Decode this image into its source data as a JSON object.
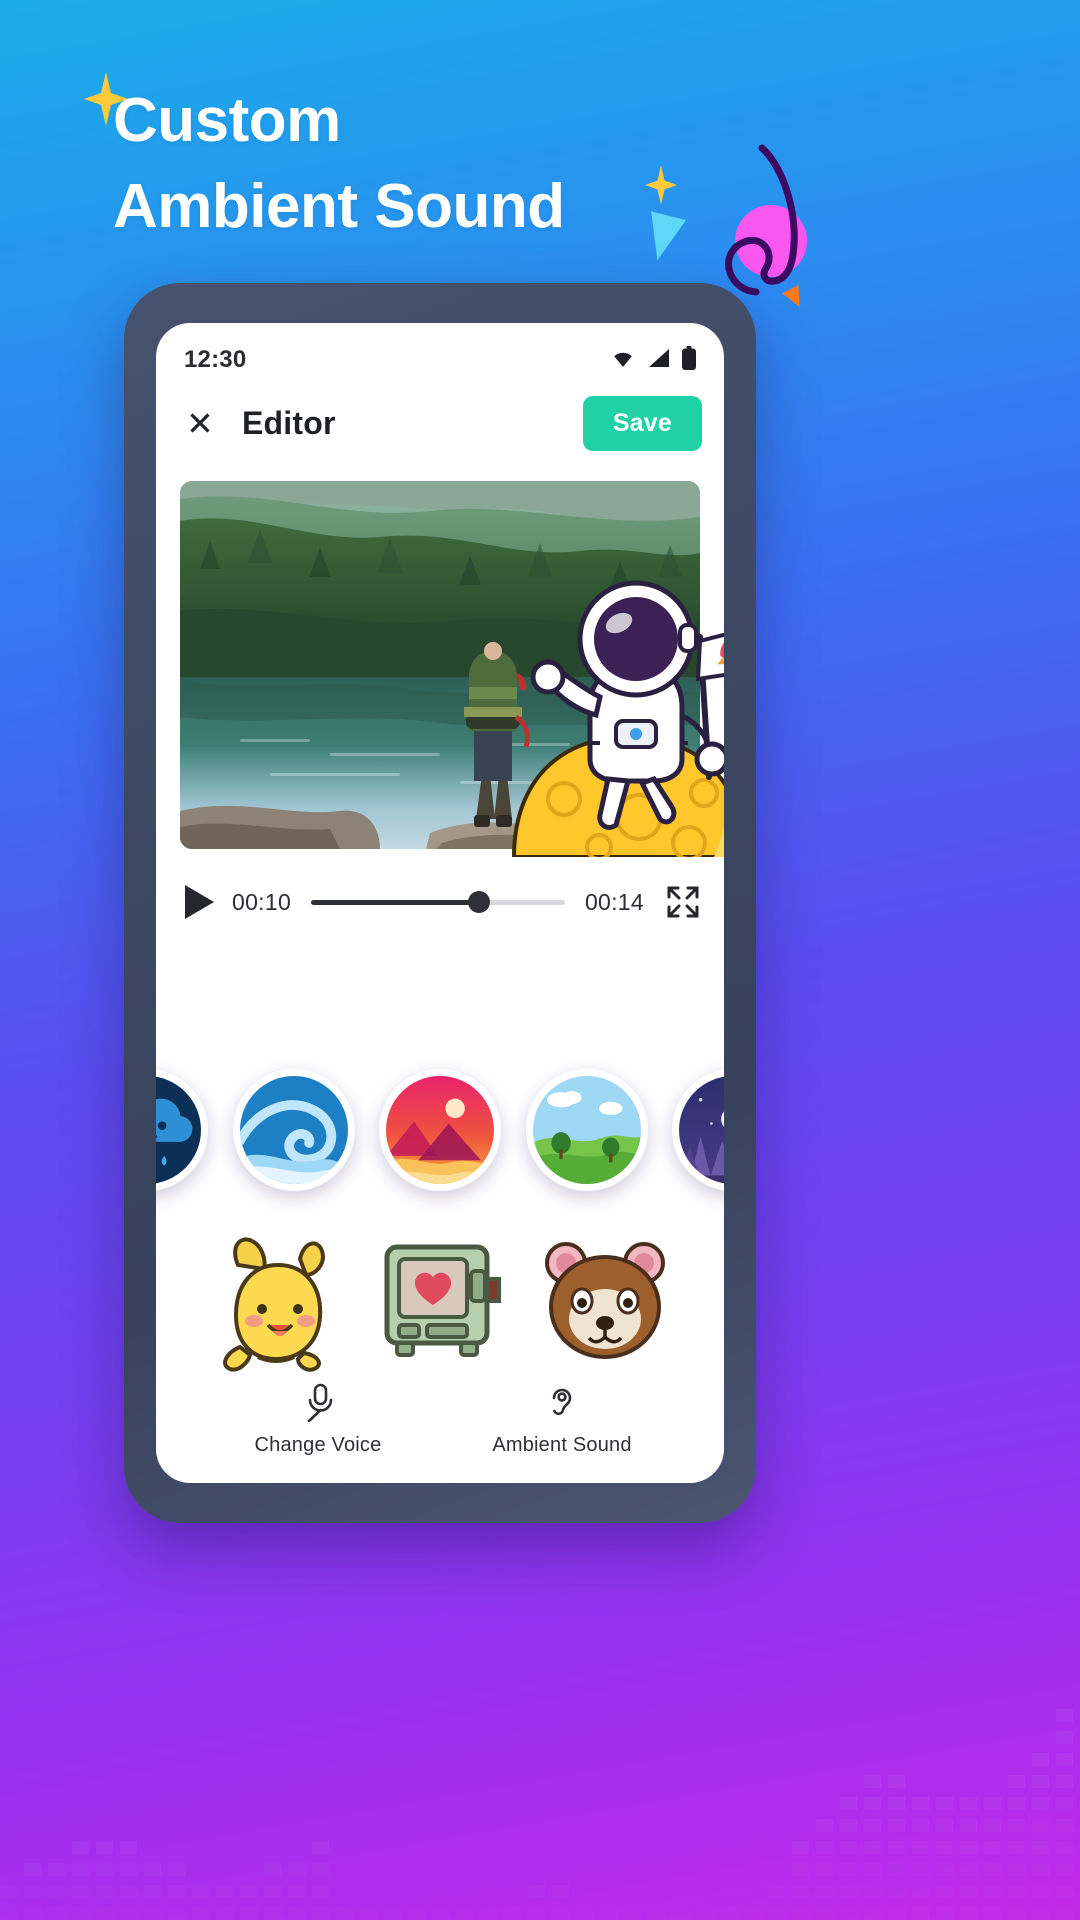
{
  "theme": {
    "bg_start": "#1aace8",
    "bg_mid": "#5a4df0",
    "bg_end": "#c32ae8",
    "accent_save": "#1fd1a5",
    "magenta_dot": "#f957ef",
    "squiggle": "#3b0b63",
    "sparkle_yellow": "#ffc93c",
    "triangle_cyan": "#5fd8f5",
    "triangle_orange": "#ff7a1a"
  },
  "headline": {
    "line1": "Custom",
    "line2": "Ambient Sound"
  },
  "decorations": [
    {
      "name": "sparkle-large",
      "color": "#ffc93c"
    },
    {
      "name": "sparkle-small",
      "color": "#ffc93c"
    },
    {
      "name": "triangle-cyan",
      "color": "#5fd8f5"
    },
    {
      "name": "triangle-orange",
      "color": "#ff7a1a"
    },
    {
      "name": "magenta-circle",
      "color": "#f957ef"
    },
    {
      "name": "squiggle-loop",
      "color": "#3b0b63"
    }
  ],
  "phone": {
    "statusbar": {
      "time": "12:30",
      "icons": [
        "wifi-icon",
        "signal-icon",
        "battery-icon"
      ]
    },
    "appbar": {
      "close_icon": "close-icon",
      "title": "Editor",
      "save_label": "Save"
    },
    "media": {
      "photo_alt": "hiker with backpack at forest lake",
      "sticker_overlay": "astronaut-on-moon-sticker"
    },
    "player": {
      "play_icon": "play-icon",
      "current_time": "00:10",
      "total_time": "00:14",
      "progress_percent": 66,
      "fullscreen_icon": "fullscreen-icon"
    },
    "ambient_sounds": [
      {
        "name": "rain",
        "icon": "rain-cloud-icon",
        "selected": true
      },
      {
        "name": "wave",
        "icon": "ocean-wave-icon",
        "selected": false
      },
      {
        "name": "sunset",
        "icon": "sunset-mountain-icon",
        "selected": false
      },
      {
        "name": "meadow",
        "icon": "green-hills-icon",
        "selected": false
      },
      {
        "name": "night",
        "icon": "night-forest-icon",
        "selected": false
      }
    ],
    "stickers": [
      {
        "name": "yellow-creature-sticker"
      },
      {
        "name": "retro-tv-heart-sticker"
      },
      {
        "name": "brown-bear-sticker"
      }
    ],
    "bottom_nav": [
      {
        "label": "Change Voice",
        "icon": "microphone-icon"
      },
      {
        "label": "Ambient Sound",
        "icon": "ear-icon"
      }
    ]
  }
}
